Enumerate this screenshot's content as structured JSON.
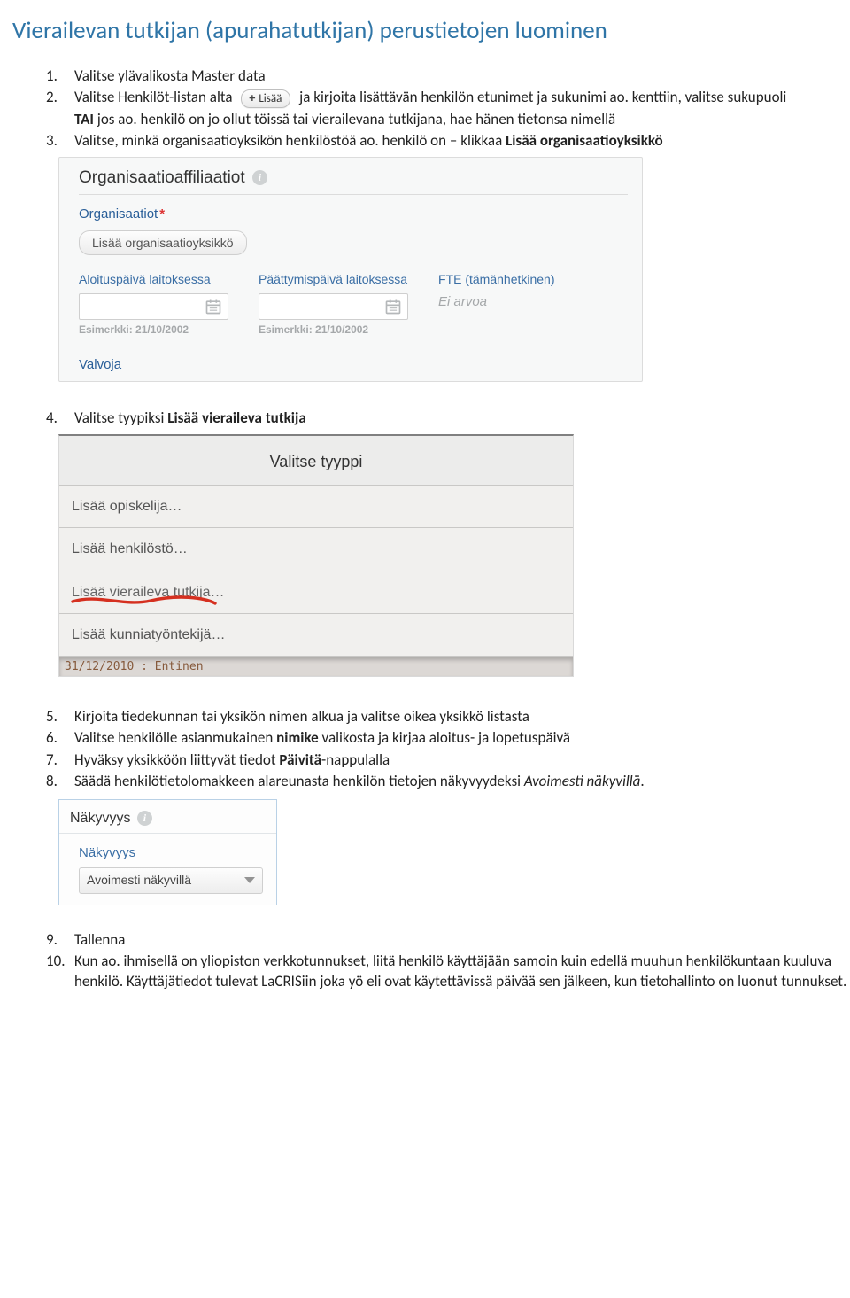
{
  "title": "Vierailevan tutkijan (apurahatutkijan) perustietojen luominen",
  "lisaa_btn": "Lisää",
  "steps": {
    "s1": "Valitse ylävalikosta Master data",
    "s2_a": "Valitse Henkilöt-listan alta",
    "s2_b": "ja kirjoita lisättävän henkilön etunimet ja sukunimi ao. kenttiin, valitse sukupuoli",
    "s2_tai_prefix": "TAI",
    "s2_tai_rest": " jos ao. henkilö on jo ollut töissä tai vierailevana tutkijana, hae hänen tietonsa nimellä",
    "s3_a": "Valitse, minkä organisaatioyksikön henkilöstöä ao. henkilö on – klikkaa ",
    "s3_b": "Lisää organisaatioyksikkö",
    "s4_a": "Valitse tyypiksi ",
    "s4_b": "Lisää vieraileva tutkija",
    "s5": "Kirjoita tiedekunnan tai yksikön nimen alkua ja valitse oikea yksikkö listasta",
    "s6_a": "Valitse henkilölle asianmukainen ",
    "s6_b": "nimike",
    "s6_c": " valikosta ja kirjaa aloitus- ja lopetuspäivä",
    "s7_a": "Hyväksy yksikköön liittyvät tiedot ",
    "s7_b": "Päivitä",
    "s7_c": "-nappulalla",
    "s8_a": "Säädä henkilötietolomakkeen alareunasta henkilön tietojen näkyvyydeksi ",
    "s8_b": "Avoimesti näkyvillä",
    "s8_c": ".",
    "s9": "Tallenna",
    "s10": "Kun ao. ihmisellä on yliopiston verkkotunnukset, liitä henkilö käyttäjään samoin kuin edellä muuhun henkilökuntaan kuuluva henkilö. Käyttäjätiedot tulevat LaCRISiin joka yö eli ovat käytettävissä päivää sen jälkeen, kun tietohallinto on luonut tunnukset."
  },
  "panel1": {
    "heading": "Organisaatioaffiliaatiot",
    "org_label": "Organisaatiot",
    "add_org": "Lisää organisaatioyksikkö",
    "col_start": "Aloituspäivä laitoksessa",
    "col_end": "Päättymispäivä laitoksessa",
    "col_fte": "FTE (tämänhetkinen)",
    "fte_value": "Ei arvoa",
    "example1": "Esimerkki: 21/10/2002",
    "example2": "Esimerkki: 21/10/2002",
    "valvoja": "Valvoja"
  },
  "panel2": {
    "title": "Valitse tyyppi",
    "opt1": "Lisää opiskelija…",
    "opt2": "Lisää henkilöstö…",
    "opt3": "Lisää vieraileva tutkija…",
    "opt4": "Lisää kunniatyöntekijä…",
    "footer": "31/12/2010 : Entinen"
  },
  "panel3": {
    "heading": "Näkyvyys",
    "sublabel": "Näkyvyys",
    "value": "Avoimesti näkyvillä"
  }
}
